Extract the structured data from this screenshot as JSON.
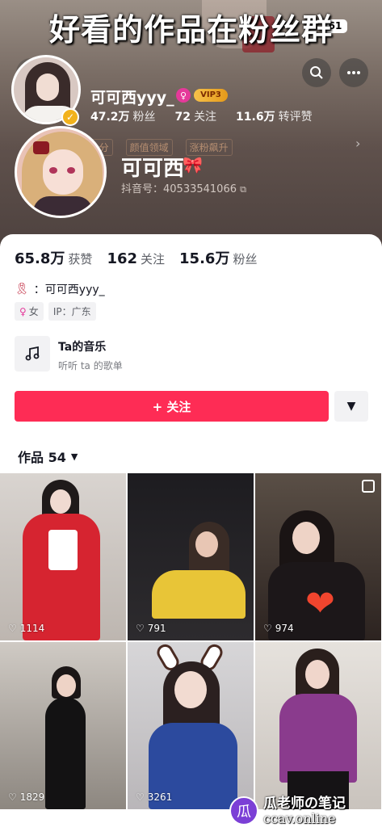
{
  "overlay": {
    "title": "好看的作品在粉丝群",
    "time_fragment": "1",
    "battery": "61"
  },
  "mini_header": {
    "name": "可可西yyy_",
    "vip_badge": "VIP3",
    "fans_count": "47.2万",
    "fans_label": "粉丝",
    "following_count": "72",
    "following_label": "关注",
    "reposts_count": "11.6万",
    "reposts_label": "转评赞"
  },
  "faded_tags": [
    "1分",
    "颜值领域",
    "涨粉飙升"
  ],
  "profile": {
    "display_name": "可可西",
    "name_emoji": "🎀",
    "douyin_id": "抖音号：40533541066"
  },
  "stats": [
    {
      "value": "65.8万",
      "label": "获赞"
    },
    {
      "value": "162",
      "label": "关注"
    },
    {
      "value": "15.6万",
      "label": "粉丝"
    }
  ],
  "bio": {
    "text": "：可可西yyy_"
  },
  "tags": {
    "gender": "女",
    "ip": "IP：广东"
  },
  "music": {
    "title": "Ta的音乐",
    "subtitle": "听听 ta 的歌单"
  },
  "follow_button": {
    "label": "+ 关注"
  },
  "works_tab": {
    "label": "作品 54"
  },
  "grid": [
    {
      "likes": "1114"
    },
    {
      "likes": "791"
    },
    {
      "likes": "974"
    },
    {
      "likes": "1829"
    },
    {
      "likes": "3261"
    },
    {
      "likes": ""
    }
  ],
  "watermark": {
    "line1": "瓜老师の笔记",
    "line2": "ccav.online"
  },
  "colors": {
    "accent": "#fe2c55",
    "text_primary": "#161823",
    "text_secondary": "#5c5f66"
  }
}
